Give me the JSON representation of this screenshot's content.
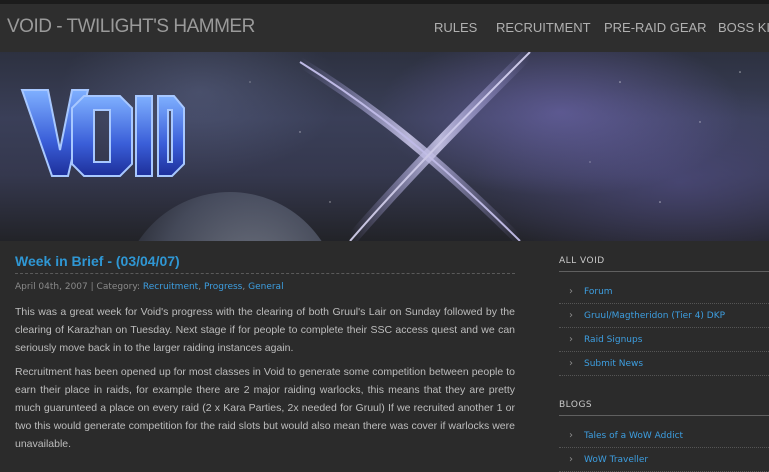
{
  "header": {
    "site_title": "VOID - TWILIGHT'S HAMMER",
    "nav": [
      "RULES",
      "RECRUITMENT",
      "PRE-RAID GEAR",
      "BOSS KIL"
    ]
  },
  "banner": {
    "logo_alt": "VOID"
  },
  "post": {
    "title": "Week in Brief - (03/04/07)",
    "date": "April 04th, 2007",
    "category_label": "Category:",
    "categories": [
      "Recruitment",
      "Progress",
      "General"
    ],
    "paragraphs": [
      "This was a great week for Void's progress with the clearing of both Gruul's Lair on Sunday followed by the clearing of Karazhan on Tuesday. Next stage if for people to complete their SSC access quest and we can seriously move back in to the larger raiding instances again.",
      "Recruitment has been opened up for most classes in Void to generate some competition between people to earn their place in raids, for example there are 2 major raiding warlocks, this means that they are pretty much guarunteed a place on every raid (2 x Kara Parties, 2x needed for Gruul) If we recruited another 1 or two this would generate competition for the raid slots but would also mean there was cover if warlocks were unavailable."
    ]
  },
  "sidebar": {
    "all_void": {
      "heading": "ALL VOID",
      "items": [
        "Forum",
        "Gruul/Magtheridon (Tier 4) DKP",
        "Raid Signups",
        "Submit News"
      ]
    },
    "blogs": {
      "heading": "BLOGS",
      "items": [
        "Tales of a WoW Addict",
        "WoW Traveller"
      ]
    }
  }
}
